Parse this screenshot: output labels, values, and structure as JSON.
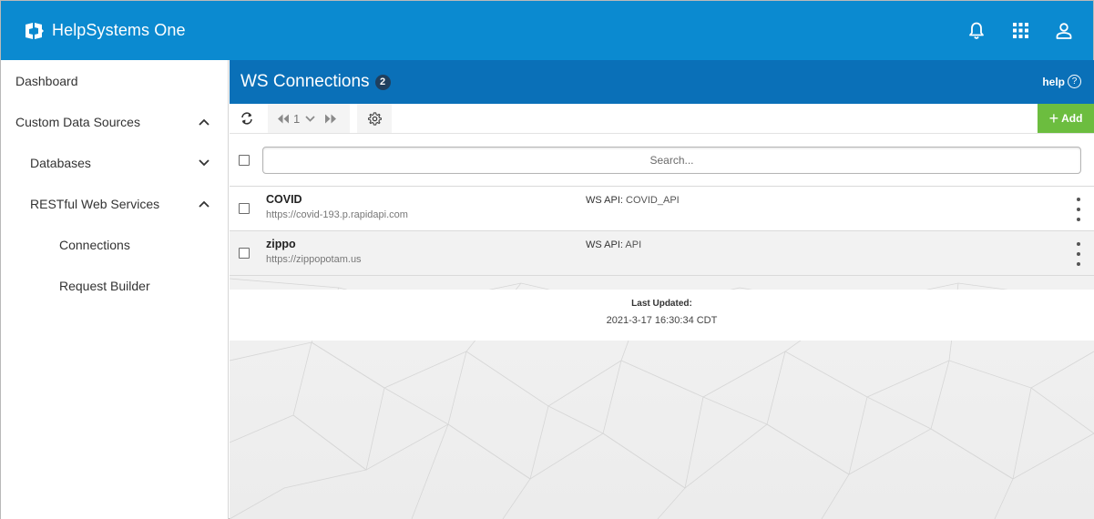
{
  "app": {
    "title": "HelpSystems One",
    "accent": "#0b8ad0",
    "header_color": "#0a70b8",
    "add_color": "#6cbd3f"
  },
  "topbar": {
    "icons": [
      "bell-icon",
      "apps-grid-icon",
      "user-icon"
    ]
  },
  "sidebar": {
    "items": [
      {
        "label": "Dashboard"
      },
      {
        "label": "Custom Data Sources"
      },
      {
        "label": "Databases"
      },
      {
        "label": "RESTful Web Services"
      },
      {
        "label": "Connections"
      },
      {
        "label": "Request Builder"
      }
    ]
  },
  "main": {
    "title": "WS Connections",
    "count": "2",
    "help_label": "help",
    "help_icon_text": "?",
    "pager": {
      "page": "1"
    },
    "add_label": "Add",
    "search": {
      "placeholder": "Search..."
    },
    "api_label": "WS API:",
    "rows": [
      {
        "name": "COVID",
        "url": "https://covid-193.p.rapidapi.com",
        "api": "COVID_API"
      },
      {
        "name": "zippo",
        "url": "https://zippopotam.us",
        "api": "API"
      }
    ],
    "footer": {
      "label": "Last Updated:",
      "value": "2021-3-17 16:30:34 CDT"
    }
  }
}
